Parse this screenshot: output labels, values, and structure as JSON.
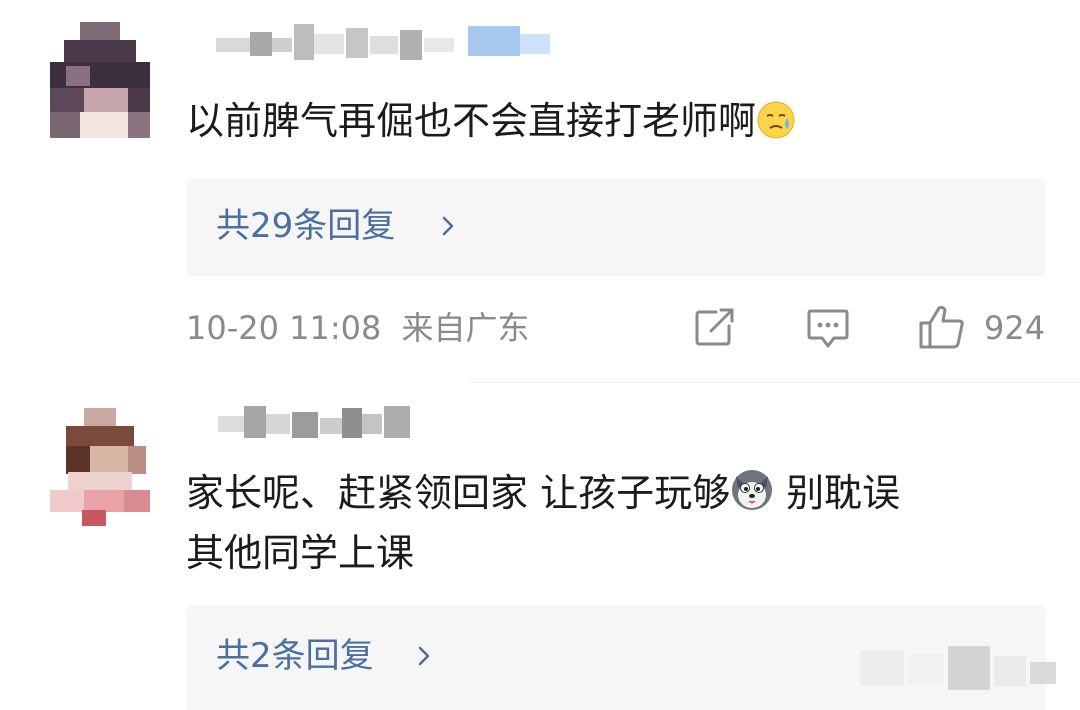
{
  "comments": [
    {
      "content": "以前脾气再倔也不会直接打老师啊",
      "emoji": "cold-sweat-face-emoji",
      "replies_label": "共29条回复",
      "timestamp": "10-20 11:08",
      "location": "来自广东",
      "like_count": "924"
    },
    {
      "content_line1": "家长呢、赶紧领回家 让孩子玩够",
      "content_line1_tail": " 别耽误",
      "content_line2": "其他同学上课",
      "emoji": "husky-dog-emoji",
      "replies_label": "共2条回复"
    }
  ],
  "colors": {
    "reply_link": "#4a6fa0",
    "meta_text": "#8a8a8a",
    "reply_box_bg": "#f6f6f6"
  },
  "icons": {
    "share": "share-icon",
    "comment": "comment-icon",
    "like": "thumbs-up-icon",
    "chevron": "chevron-right-icon"
  }
}
